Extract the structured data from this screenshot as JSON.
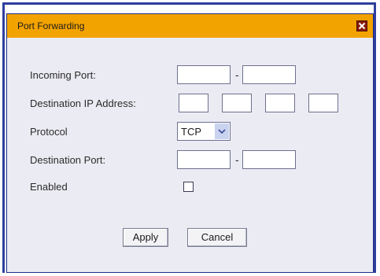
{
  "dialog": {
    "title": "Port Forwarding",
    "close_icon": "close-icon"
  },
  "form": {
    "incoming_port_label": "Incoming Port:",
    "incoming_port_start": "",
    "incoming_port_end": "",
    "range_separator": "-",
    "destination_ip_label": "Destination IP Address:",
    "destination_ip_octets": [
      "",
      "",
      "",
      ""
    ],
    "protocol_label": "Protocol",
    "protocol_value": "TCP",
    "destination_port_label": "Destination Port:",
    "destination_port_start": "",
    "destination_port_end": "",
    "enabled_label": "Enabled",
    "enabled_checked": false
  },
  "buttons": {
    "apply": "Apply",
    "cancel": "Cancel"
  },
  "colors": {
    "title_bar": "#f3a300",
    "frame_border": "#2f3f9e",
    "dialog_background": "#ebebf3",
    "close_button": "#8a1c0c"
  }
}
